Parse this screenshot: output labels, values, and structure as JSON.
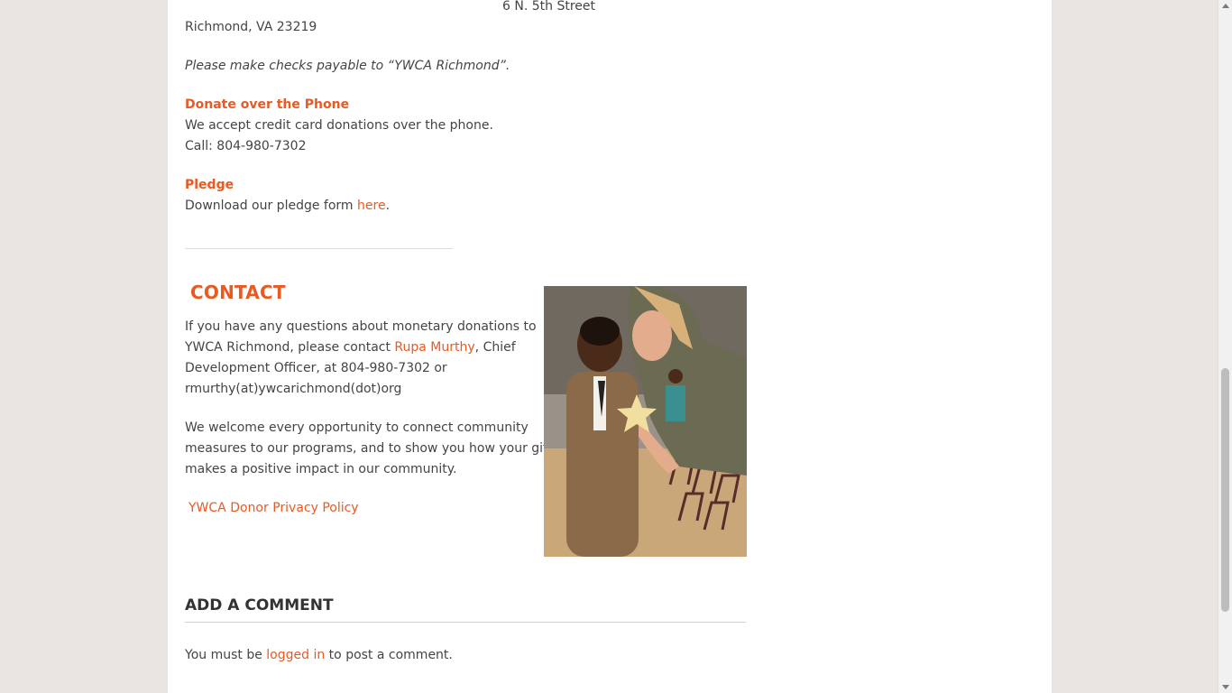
{
  "address": {
    "street": "6 N. 5th Street",
    "city": "Richmond, VA 23219",
    "checks_note": "Please make checks payable to “YWCA Richmond”."
  },
  "phone_donation": {
    "heading": "Donate over the Phone",
    "line1": "We accept credit card donations over the phone.",
    "line2": "Call: 804-980-7302"
  },
  "pledge": {
    "heading": "Pledge",
    "text_before": "Download our pledge form ",
    "link": "here",
    "text_after": "."
  },
  "contact": {
    "heading": "CONTACT",
    "p1_line1": "If you have any questions about monetary donations to",
    "p1_line2_before": "YWCA Richmond, please contact ",
    "p1_link": "Rupa Murthy",
    "p1_line2_after": ", Chief",
    "p1_line3": "Development Officer, at 804-980-7302 or",
    "p1_line4": "rmurthy(at)ywcarichmond(dot)org",
    "p2_line1": "We welcome every opportunity to connect community",
    "p2_line2": "measures to our programs, and to show you how your gift",
    "p2_line3": "makes a positive impact in our community.",
    "privacy_link": "YWCA Donor Privacy Policy"
  },
  "comments": {
    "heading": "ADD A COMMENT",
    "text_before": "You must be ",
    "link": "logged in",
    "text_after": " to post a comment."
  },
  "colors": {
    "accent": "#e85a22",
    "background": "#e8e5e3",
    "content": "#ffffff"
  }
}
